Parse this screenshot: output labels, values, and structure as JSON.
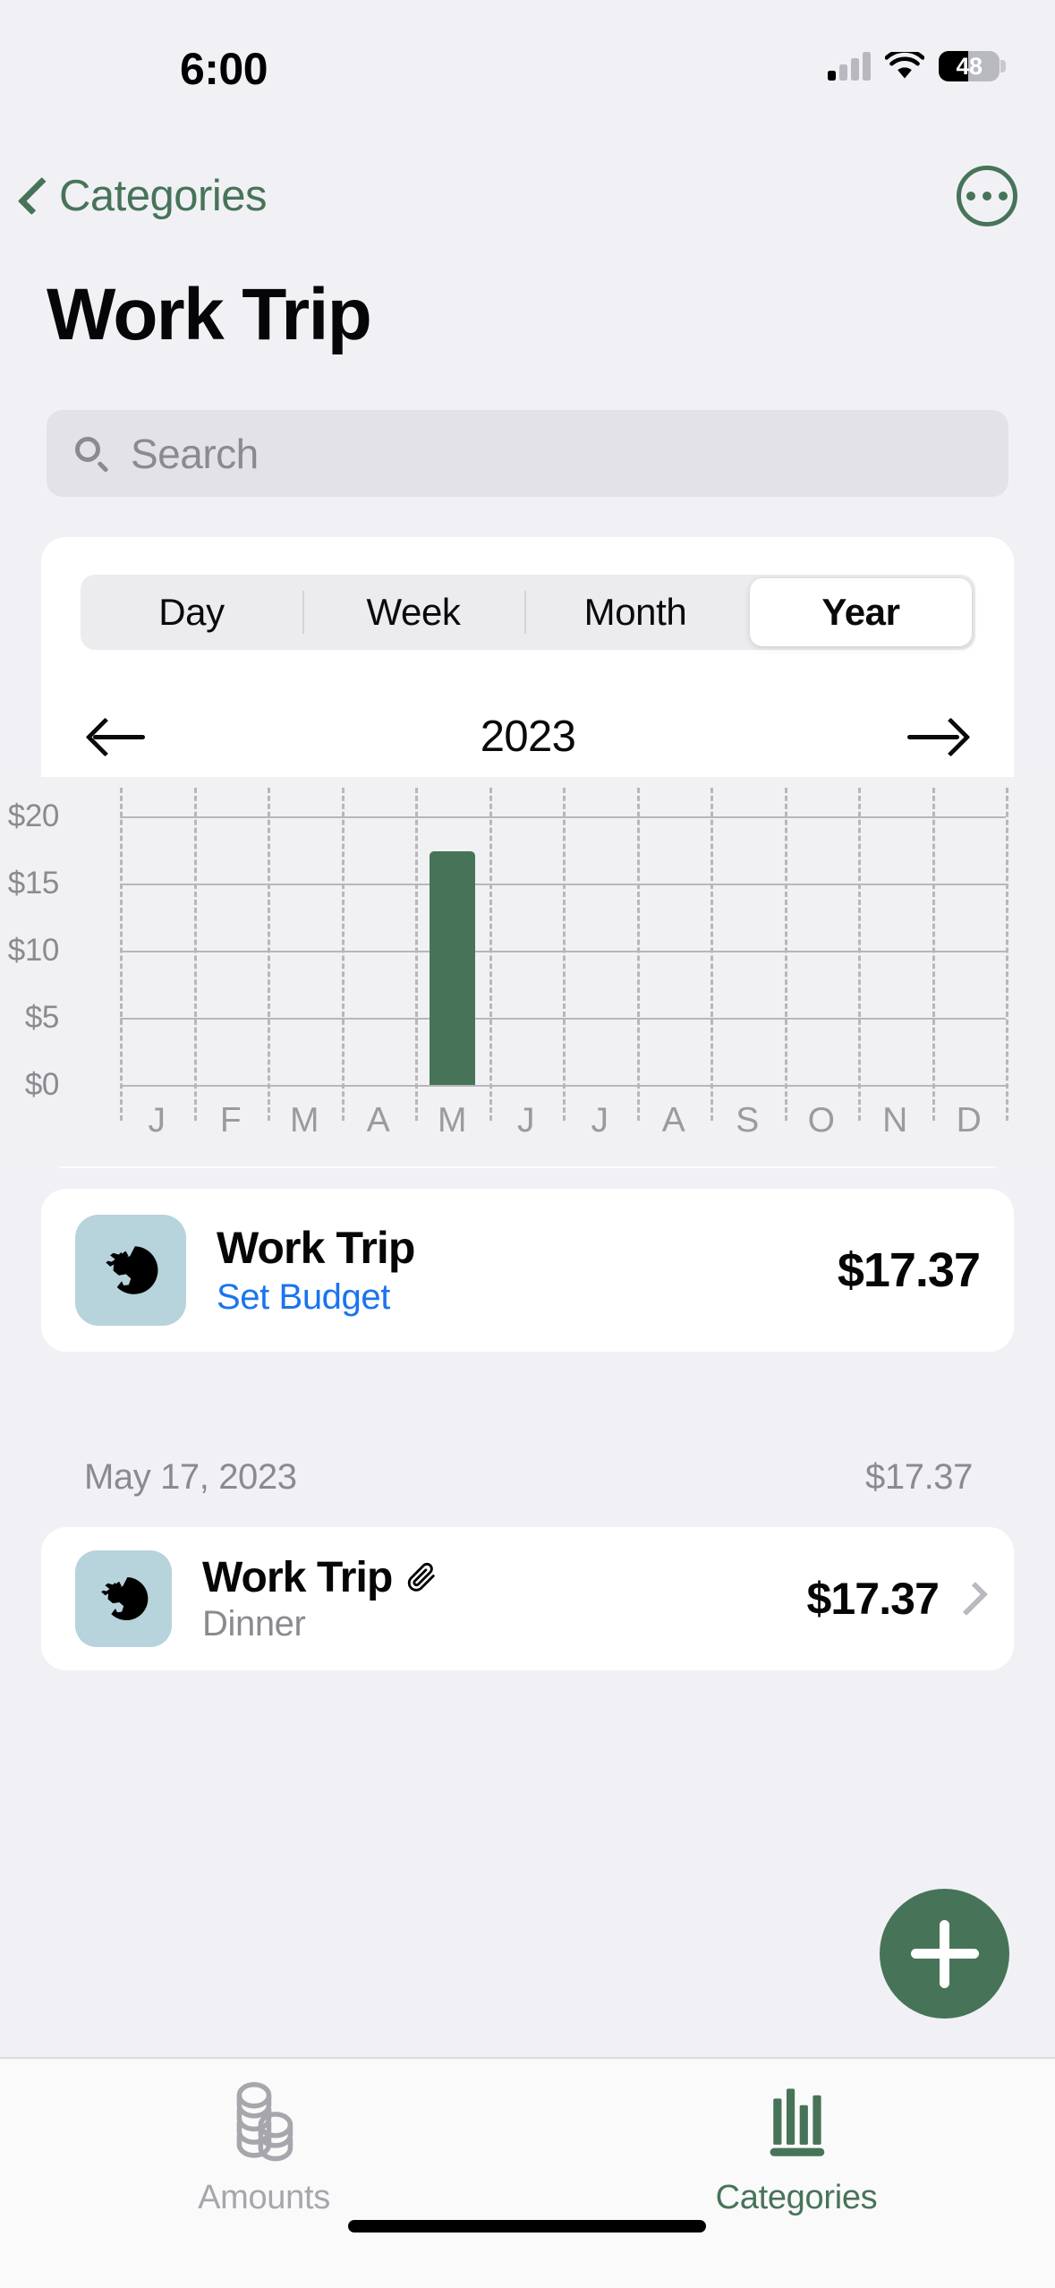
{
  "status_bar": {
    "time": "6:00",
    "battery_percent": "48",
    "battery_level": 48,
    "signal_icon": "cellular-signal-icon",
    "wifi_icon": "wifi-icon",
    "battery_icon": "battery-icon"
  },
  "nav": {
    "back_label": "Categories",
    "back_icon": "chevron-left-icon",
    "more_icon": "ellipsis-circle-icon"
  },
  "header": {
    "title": "Work Trip"
  },
  "search": {
    "placeholder": "Search",
    "value": "",
    "icon": "search-icon"
  },
  "chart_card": {
    "segments": [
      {
        "label": "Day",
        "active": false
      },
      {
        "label": "Week",
        "active": false
      },
      {
        "label": "Month",
        "active": false
      },
      {
        "label": "Year",
        "active": true
      }
    ],
    "period_label": "2023",
    "prev_icon": "arrow-left-icon",
    "next_icon": "arrow-right-icon"
  },
  "chart_data": {
    "type": "bar",
    "title": "",
    "xlabel": "",
    "ylabel": "",
    "categories": [
      "J",
      "F",
      "M",
      "A",
      "M",
      "J",
      "J",
      "A",
      "S",
      "O",
      "N",
      "D"
    ],
    "category_names": [
      "January",
      "February",
      "March",
      "April",
      "May",
      "June",
      "July",
      "August",
      "September",
      "October",
      "November",
      "December"
    ],
    "values": [
      0,
      0,
      0,
      0,
      17.37,
      0,
      0,
      0,
      0,
      0,
      0,
      0
    ],
    "ytick_labels": [
      "$0",
      "$5",
      "$10",
      "$15",
      "$20"
    ],
    "yticks": [
      0,
      5,
      10,
      15,
      20
    ],
    "ylim": [
      0,
      20
    ],
    "grid": true,
    "legend": "none",
    "bar_color": "#477458",
    "currency": "$"
  },
  "category_row": {
    "icon": "globe-airplane-icon",
    "name": "Work Trip",
    "budget_link": "Set Budget",
    "amount": "$17.37"
  },
  "transactions": {
    "date_header": "May 17, 2023",
    "date_total": "$17.37",
    "items": [
      {
        "icon": "globe-airplane-icon",
        "name": "Work Trip",
        "attachment_icon": "paperclip-icon",
        "subtitle": "Dinner",
        "amount": "$17.37",
        "chevron": "chevron-right-icon"
      }
    ]
  },
  "fab": {
    "icon": "plus-icon",
    "label": "Add"
  },
  "tab_bar": {
    "tabs": [
      {
        "label": "Amounts",
        "icon": "coins-stack-icon",
        "active": false
      },
      {
        "label": "Categories",
        "icon": "bar-chart-icon",
        "active": true
      }
    ]
  },
  "colors": {
    "accent_green": "#477458",
    "link_blue": "#1a74ef",
    "icon_tile_blue": "#b7d3dc",
    "background": "#f1f1f5",
    "card": "#ffffff",
    "muted_text": "#8a8a90"
  }
}
